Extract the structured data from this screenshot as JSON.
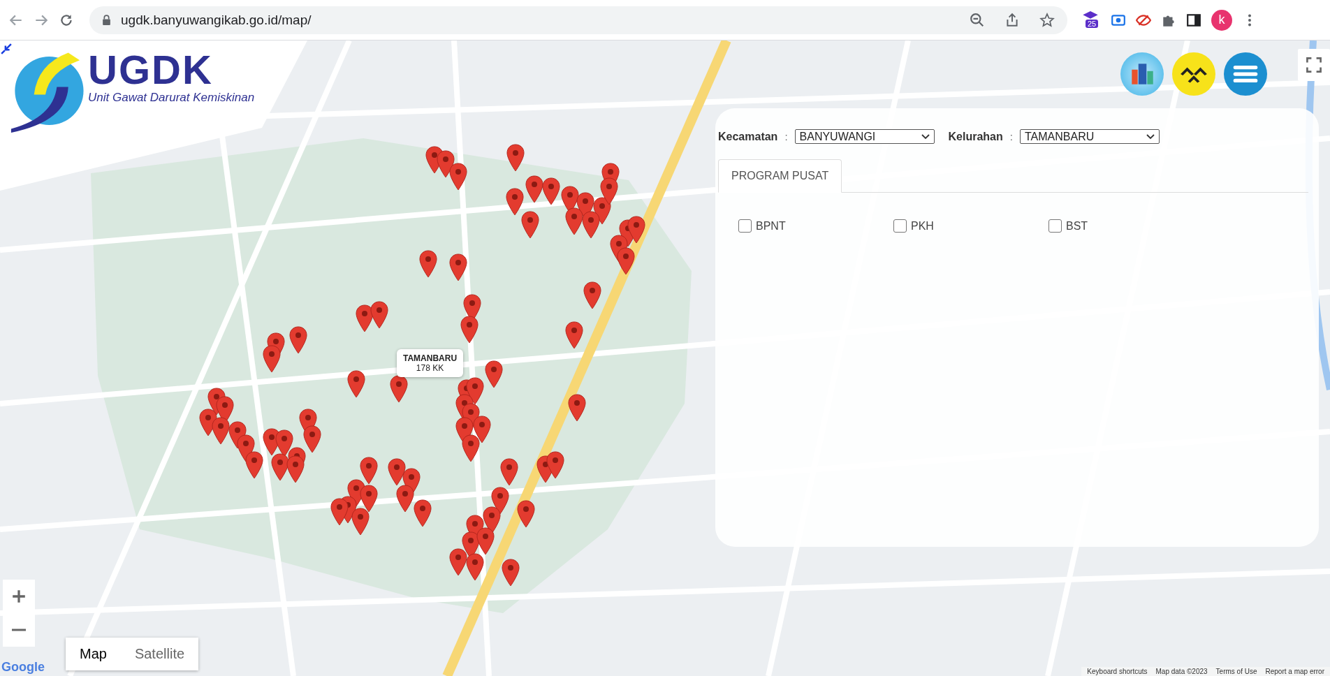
{
  "browser": {
    "url": "ugdk.banyuwangikab.go.id/map/",
    "extension_badge": "25",
    "profile_initial": "k"
  },
  "logo": {
    "title": "UGDK",
    "subtitle": "Unit Gawat Darurat Kemiskinan"
  },
  "panel": {
    "filters": [
      {
        "label": "Kecamatan",
        "separator": ":",
        "value": "BANYUWANGI"
      },
      {
        "label": "Kelurahan",
        "separator": ":",
        "value": "TAMANBARU"
      }
    ],
    "tabs": [
      {
        "label": "PROGRAM PUSAT",
        "selected": true
      }
    ],
    "programs": [
      {
        "label": "BPNT",
        "checked": false
      },
      {
        "label": "PKH",
        "checked": false
      },
      {
        "label": "BST",
        "checked": false
      }
    ]
  },
  "map_tooltip": {
    "title": "TAMANBARU",
    "count": "178 KK"
  },
  "map_type": [
    {
      "label": "Map",
      "selected": true
    },
    {
      "label": "Satellite",
      "selected": false
    }
  ],
  "map_logo": "Google",
  "map_footer": [
    "Keyboard shortcuts",
    "Map data ©2023",
    "Terms of Use",
    "Report a map error"
  ]
}
